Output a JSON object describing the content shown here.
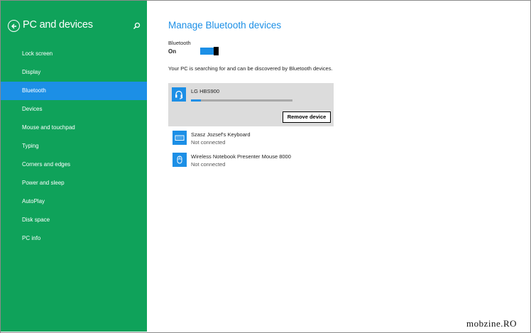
{
  "sidebar": {
    "title": "PC and devices",
    "items": [
      {
        "label": "Lock screen"
      },
      {
        "label": "Display"
      },
      {
        "label": "Bluetooth",
        "active": true
      },
      {
        "label": "Devices"
      },
      {
        "label": "Mouse and touchpad"
      },
      {
        "label": "Typing"
      },
      {
        "label": "Corners and edges"
      },
      {
        "label": "Power and sleep"
      },
      {
        "label": "AutoPlay"
      },
      {
        "label": "Disk space"
      },
      {
        "label": "PC info"
      }
    ],
    "icons": {
      "back": "back-arrow-icon",
      "search": "search-icon"
    }
  },
  "main": {
    "title": "Manage Bluetooth devices",
    "bluetooth_label": "Bluetooth",
    "bluetooth_state": "On",
    "status_text": "Your PC is searching for and can be discovered by Bluetooth devices.",
    "devices": [
      {
        "name": "LG HBS900",
        "icon": "headset-icon",
        "progress": 0.1,
        "action": "Remove device"
      },
      {
        "name": "Szasz Jozsef's Keyboard",
        "icon": "keyboard-icon",
        "status": "Not connected"
      },
      {
        "name": "Wireless Notebook Presenter Mouse 8000",
        "icon": "mouse-icon",
        "status": "Not connected"
      }
    ]
  },
  "watermark": "mobzine.RO",
  "colors": {
    "sidebar": "#0fa25a",
    "accent": "#1c8fe6",
    "selected_bg": "#dcdcdc"
  }
}
